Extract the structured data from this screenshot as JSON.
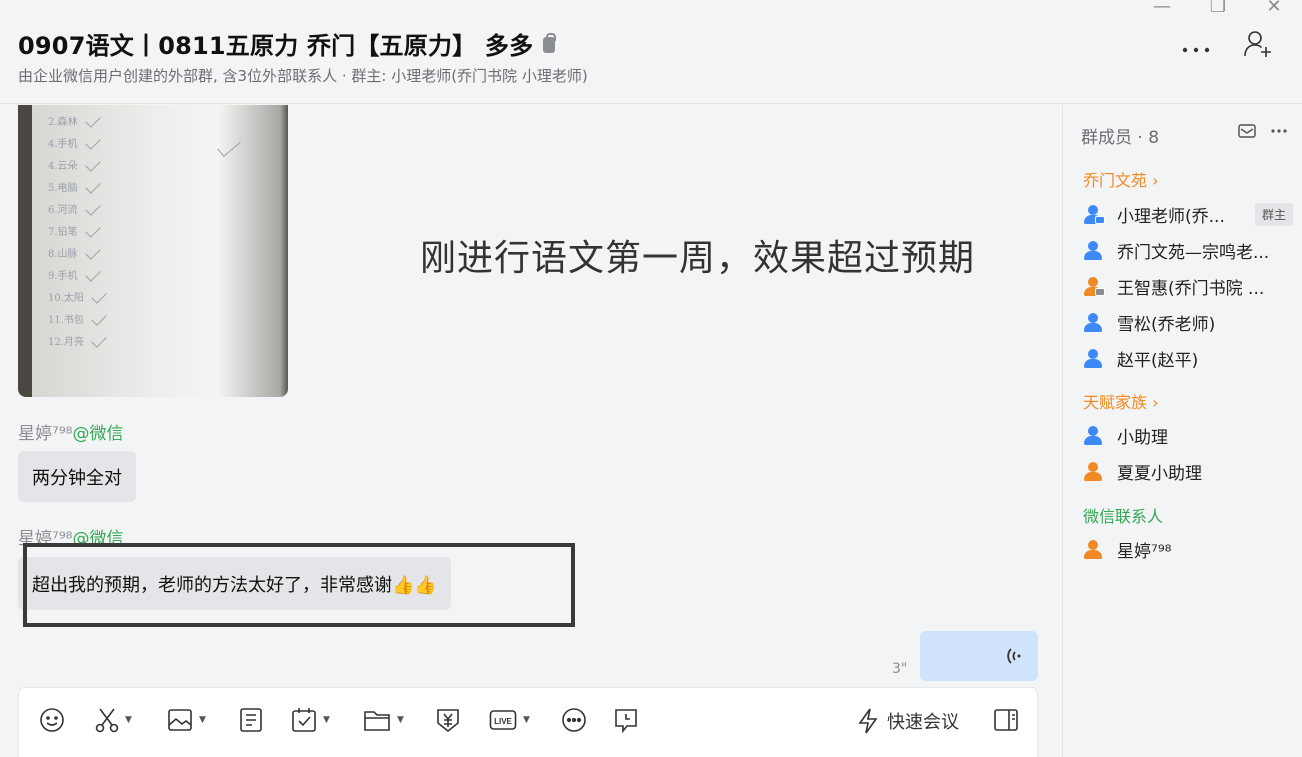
{
  "header": {
    "title": "0907语文丨0811五原力 乔门【五原力】 多多",
    "subtitle": "由企业微信用户创建的外部群, 含3位外部联系人 · 群主: 小理老师(乔门书院 小理老师)",
    "more_icon": "more-horizontal-icon",
    "add_member_icon": "add-person-icon"
  },
  "window": {
    "minimize": "—",
    "restore": "❐",
    "close": "✕"
  },
  "chat": {
    "image_caption": "刚进行语文第一周，效果超过预期",
    "messages": [
      {
        "sender": "星婷⁷⁹⁸",
        "source": "@微信",
        "text": "两分钟全对"
      },
      {
        "sender": "星婷⁷⁹⁸",
        "source": "@微信",
        "text": "超出我的预期，老师的方法太好了，非常感谢👍👍"
      }
    ],
    "voice": {
      "duration": "3\""
    }
  },
  "composer": {
    "tools": [
      "emoji-icon",
      "scissors-icon",
      "image-icon",
      "document-icon",
      "calendar-check-icon",
      "folder-icon",
      "payment-icon",
      "live-icon",
      "more-icon",
      "schedule-icon"
    ],
    "meeting_label": "快速会议"
  },
  "members": {
    "header": "群成员 · 8",
    "groups": [
      {
        "label": "乔门文苑 ›",
        "color": "#f08a24"
      },
      {
        "label": "天赋家族 ›",
        "color": "#f08a24"
      },
      {
        "label": "微信联系人",
        "color": "#34a853"
      }
    ],
    "list": [
      {
        "name": "小理老师(乔...",
        "badge": "群主"
      },
      {
        "name": "乔门文苑—宗鸣老..."
      },
      {
        "name": "王智惠(乔门书院 ..."
      },
      {
        "name": "雪松(乔老师)"
      },
      {
        "name": "赵平(赵平)"
      },
      {
        "name": "小助理"
      },
      {
        "name": "夏夏小助理"
      },
      {
        "name": "星婷⁷⁹⁸"
      }
    ]
  }
}
